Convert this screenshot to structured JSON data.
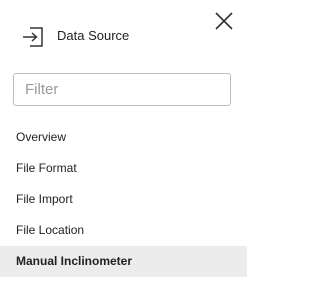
{
  "header": {
    "icon": "source-import-icon",
    "title": "Data Source",
    "close_icon": "close-icon"
  },
  "filter": {
    "value": "",
    "placeholder": "Filter"
  },
  "nav": {
    "items": [
      {
        "label": "Overview",
        "active": false
      },
      {
        "label": "File Format",
        "active": false
      },
      {
        "label": "File Import",
        "active": false
      },
      {
        "label": "File Location",
        "active": false
      },
      {
        "label": "Manual Inclinometer",
        "active": true
      }
    ]
  },
  "colors": {
    "active_background": "#ececec",
    "border": "#bdbdbd",
    "text": "#222222",
    "placeholder": "#9a9a9a"
  }
}
